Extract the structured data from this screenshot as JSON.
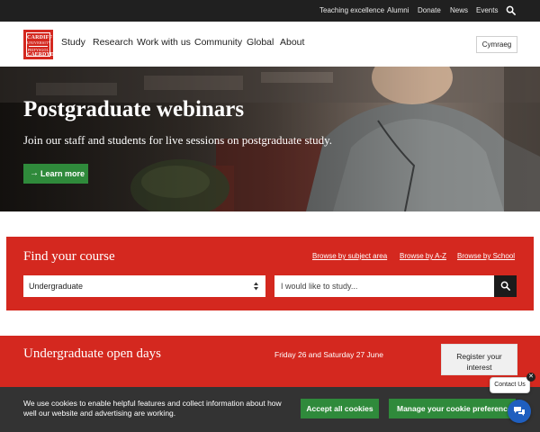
{
  "utility": {
    "links": [
      "Teaching excellence",
      "Alumni",
      "Donate",
      "News",
      "Events"
    ],
    "search_icon": "search-icon"
  },
  "logo": {
    "line1": "CARDIFF",
    "line2": "UNIVERSITY",
    "line3": "PRIFYSGOL",
    "line4": "CAERDYD"
  },
  "nav": {
    "items": [
      "Study",
      "Research",
      "Work with us",
      "Community",
      "Global",
      "About"
    ],
    "language_button": "Cymraeg"
  },
  "hero": {
    "title": "Postgraduate webinars",
    "subtitle": "Join our staff and students for live sessions on postgraduate study.",
    "button_label": "Learn more",
    "button_color": "#2f8a3b"
  },
  "find_course": {
    "title": "Find your course",
    "browse_links": [
      "Browse by subject area",
      "Browse by A-Z",
      "Browse by School"
    ],
    "level_selected": "Undergraduate",
    "search_placeholder": "I would like to study...",
    "panel_color": "#d4281f"
  },
  "open_days": {
    "title": "Undergraduate open days",
    "date": "Friday 26 and Saturday 27 June",
    "button_label": "Register your interest"
  },
  "cookies": {
    "text": "We use cookies to enable helpful features and collect information about how well our website and advertising are working.",
    "accept_label": "Accept all cookies",
    "manage_label": "Manage your cookie preferences"
  },
  "contact_widget": {
    "label": "Contact Us",
    "close_glyph": "✕",
    "chat_icon": "chat-icon"
  }
}
